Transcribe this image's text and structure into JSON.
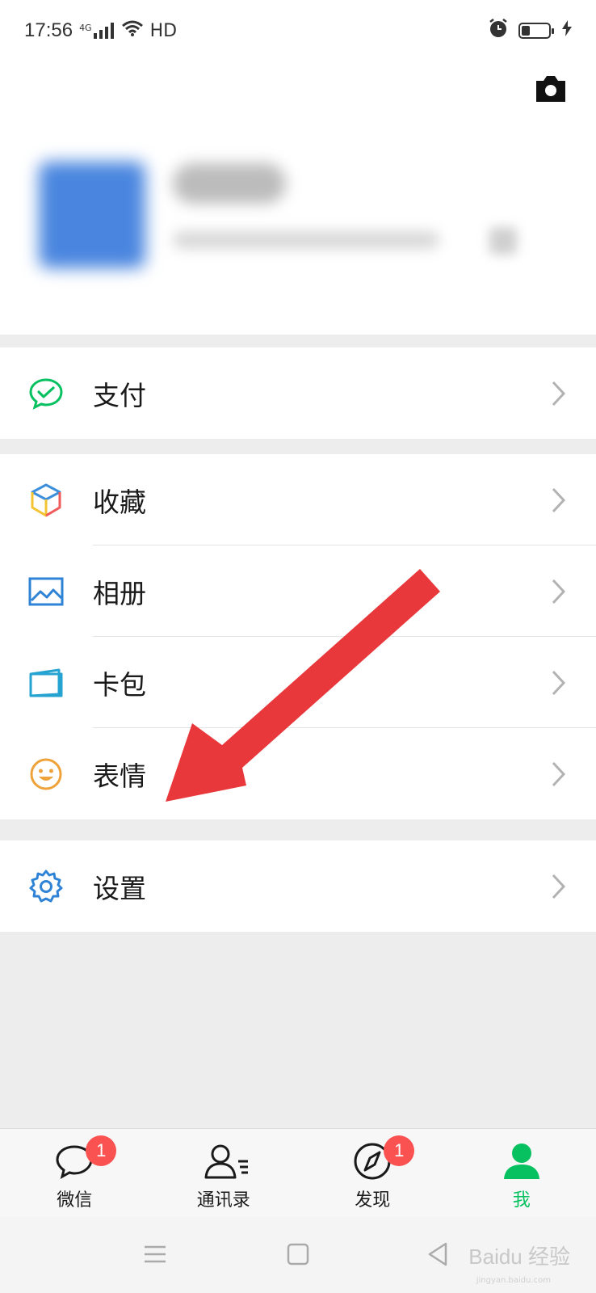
{
  "status_bar": {
    "time": "17:56",
    "network": "4G",
    "hd": "HD"
  },
  "profile": {
    "camera_icon": "camera-icon"
  },
  "menu": {
    "pay": {
      "label": "支付",
      "icon": "wechat-pay-icon"
    },
    "favorites": {
      "label": "收藏",
      "icon": "cube-icon"
    },
    "album": {
      "label": "相册",
      "icon": "picture-icon"
    },
    "cards": {
      "label": "卡包",
      "icon": "card-wallet-icon"
    },
    "stickers": {
      "label": "表情",
      "icon": "smiley-icon"
    },
    "settings": {
      "label": "设置",
      "icon": "gear-icon"
    }
  },
  "tabbar": {
    "tabs": [
      {
        "label": "微信",
        "badge": "1",
        "icon": "chat-bubble-icon"
      },
      {
        "label": "通讯录",
        "icon": "contacts-icon"
      },
      {
        "label": "发现",
        "badge": "1",
        "icon": "compass-icon"
      },
      {
        "label": "我",
        "icon": "person-icon",
        "active": true
      }
    ]
  },
  "watermark": {
    "text": "Baidu 经验",
    "sub": "jingyan.baidu.com"
  },
  "colors": {
    "accent_green": "#07c160",
    "badge_red": "#fa5151",
    "arrow_red": "#e8383b",
    "background": "#ededed"
  }
}
